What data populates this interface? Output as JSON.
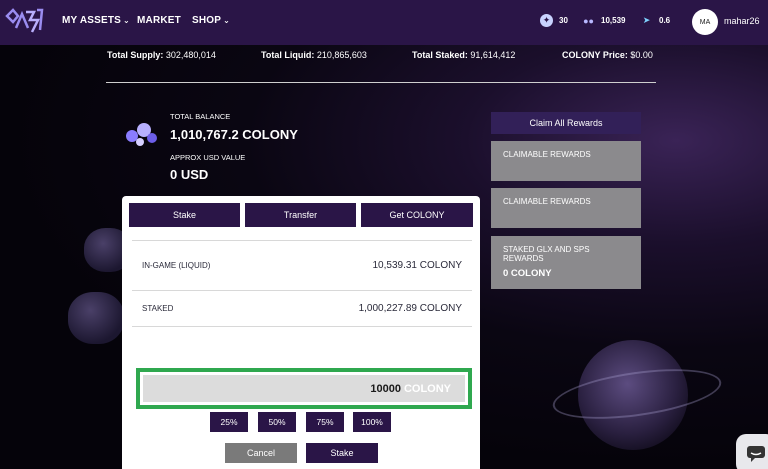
{
  "nav": {
    "items": [
      {
        "label": "MY ASSETS",
        "dropdown": true
      },
      {
        "label": "MARKET",
        "dropdown": false
      },
      {
        "label": "SHOP",
        "dropdown": true
      }
    ],
    "stats": [
      {
        "icon": "credits-icon",
        "value": "30"
      },
      {
        "icon": "crowd-icon",
        "value": "10,539"
      },
      {
        "icon": "rocket-icon",
        "value": "0.6"
      }
    ],
    "user": {
      "initials": "MA",
      "name": "mahar26"
    }
  },
  "supply": {
    "total_supply_label": "Total Supply:",
    "total_supply": "302,480,014",
    "total_liquid_label": "Total Liquid:",
    "total_liquid": "210,865,603",
    "total_staked_label": "Total Staked:",
    "total_staked": "91,614,412",
    "price_label": "COLONY Price:",
    "price": "$0.00"
  },
  "balance": {
    "total_label": "TOTAL BALANCE",
    "total_value": "1,010,767.2 COLONY",
    "usd_label": "APPROX USD VALUE",
    "usd_value": "0 USD"
  },
  "rewards": {
    "claim_all": "Claim All Rewards",
    "cards": [
      {
        "label": "CLAIMABLE REWARDS",
        "value": ""
      },
      {
        "label": "CLAIMABLE REWARDS",
        "value": ""
      },
      {
        "label": "STAKED GLX AND SPS REWARDS",
        "value": "0 COLONY"
      }
    ]
  },
  "panel": {
    "tabs": [
      "Stake",
      "Transfer",
      "Get COLONY"
    ],
    "rows": [
      {
        "label": "IN-GAME (LIQUID)",
        "value": "10,539.31 COLONY"
      },
      {
        "label": "STAKED",
        "value": "1,000,227.89 COLONY"
      }
    ],
    "amount": {
      "value": "10000",
      "suffix": "COLONY"
    },
    "percent_buttons": [
      "25%",
      "50%",
      "75%",
      "100%"
    ],
    "cancel": "Cancel",
    "stake": "Stake"
  },
  "colors": {
    "nav_bg": "#2a1547",
    "button_bg": "#2a1547",
    "card_bg": "#8b8a8d",
    "highlight": "#2fa84f",
    "cancel_bg": "#7a7a7a"
  }
}
